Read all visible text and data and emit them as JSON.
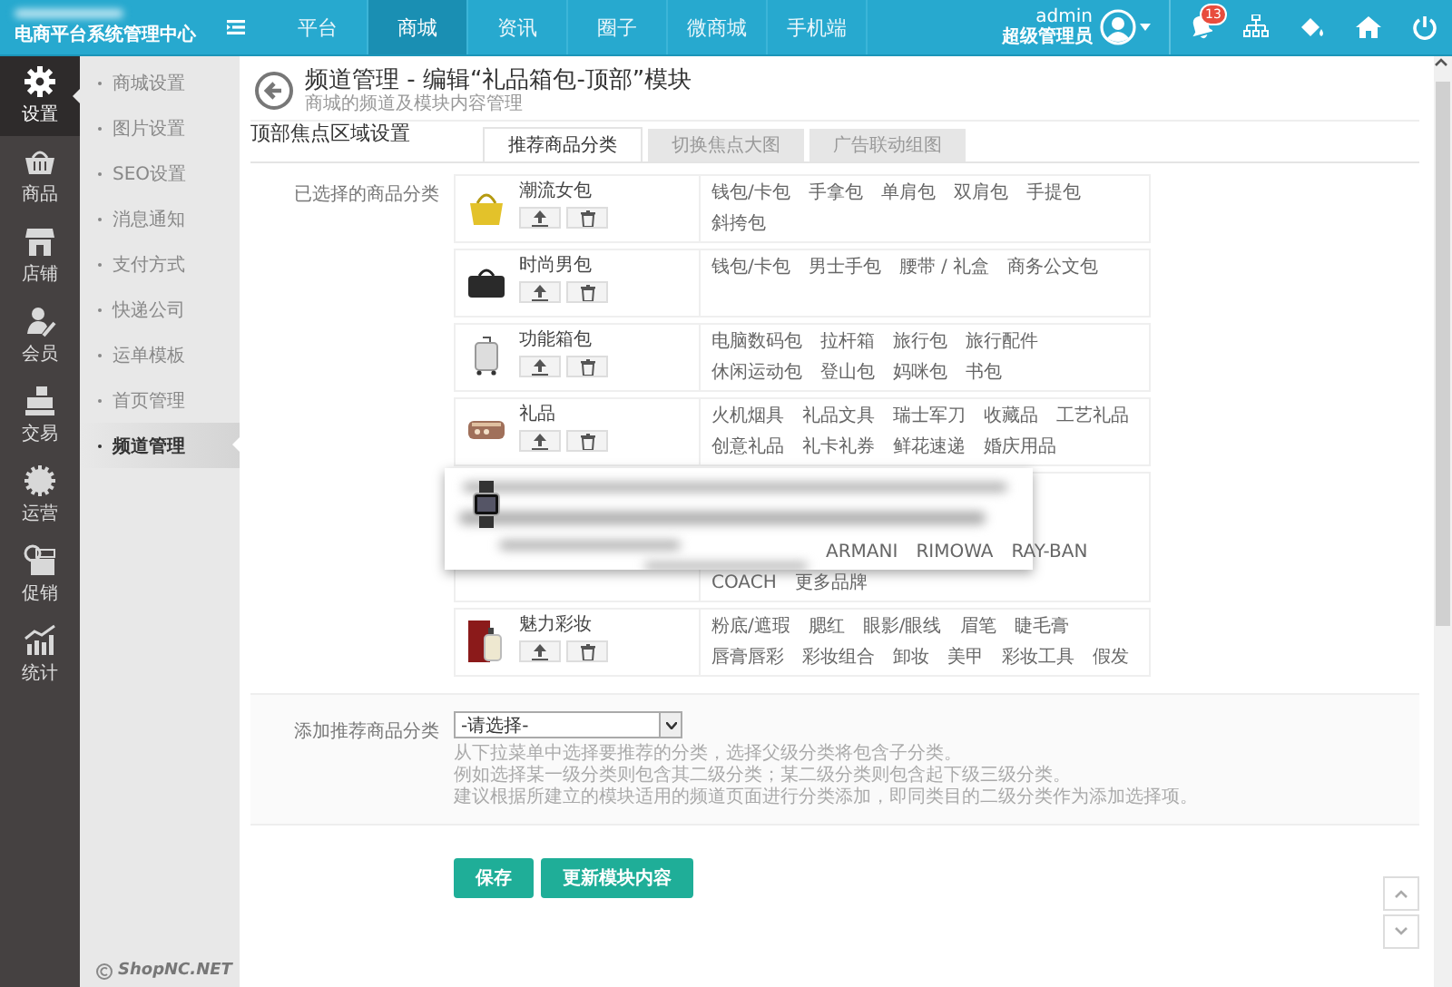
{
  "app": {
    "logo_text": "电商平台系统管理中心"
  },
  "nav": [
    {
      "label": "平台",
      "selected": false
    },
    {
      "label": "商城",
      "selected": true
    },
    {
      "label": "资讯",
      "selected": false
    },
    {
      "label": "圈子",
      "selected": false
    },
    {
      "label": "微商城",
      "selected": false
    },
    {
      "label": "手机端",
      "selected": false
    }
  ],
  "user": {
    "name": "admin",
    "role": "超级管理员"
  },
  "notifications": {
    "count": "13"
  },
  "sidebar": [
    {
      "label": "设置",
      "kind": "gear",
      "selected": true
    },
    {
      "label": "商品",
      "kind": "basket",
      "selected": false
    },
    {
      "label": "店铺",
      "kind": "shop",
      "selected": false
    },
    {
      "label": "会员",
      "kind": "member",
      "selected": false
    },
    {
      "label": "交易",
      "kind": "register",
      "selected": false
    },
    {
      "label": "运营",
      "kind": "badge",
      "selected": false
    },
    {
      "label": "促销",
      "kind": "promo",
      "selected": false
    },
    {
      "label": "统计",
      "kind": "chart",
      "selected": false
    }
  ],
  "submenu": [
    {
      "label": "商城设置",
      "selected": false
    },
    {
      "label": "图片设置",
      "selected": false
    },
    {
      "label": "SEO设置",
      "selected": false
    },
    {
      "label": "消息通知",
      "selected": false
    },
    {
      "label": "支付方式",
      "selected": false
    },
    {
      "label": "快递公司",
      "selected": false
    },
    {
      "label": "运单模板",
      "selected": false
    },
    {
      "label": "首页管理",
      "selected": false
    },
    {
      "label": "频道管理",
      "selected": true
    }
  ],
  "footer": "ShopNC.NET",
  "page": {
    "title": "频道管理 - 编辑“礼品箱包-顶部”模块",
    "subtitle": "商城的频道及模块内容管理"
  },
  "section": {
    "title": "顶部焦点区域设置"
  },
  "tabs": [
    {
      "label": "推荐商品分类",
      "selected": true
    },
    {
      "label": "切换焦点大图",
      "selected": false
    },
    {
      "label": "广告联动组图",
      "selected": false
    }
  ],
  "selected_categories": {
    "label": "已选择的商品分类",
    "rows": [
      {
        "name": "潮流女包",
        "kind": "handbag",
        "redacted": false,
        "items": [
          "钱包/卡包",
          "手拿包",
          "单肩包",
          "双肩包",
          "手提包",
          "斜挎包"
        ]
      },
      {
        "name": "时尚男包",
        "kind": "briefcase",
        "redacted": false,
        "items": [
          "钱包/卡包",
          "男士手包",
          "腰带 / 礼盒",
          "商务公文包"
        ]
      },
      {
        "name": "功能箱包",
        "kind": "luggage",
        "redacted": false,
        "items": [
          "电脑数码包",
          "拉杆箱",
          "旅行包",
          "旅行配件",
          "休闲运动包",
          "登山包",
          "妈咪包",
          "书包"
        ]
      },
      {
        "name": "礼品",
        "kind": "gift",
        "redacted": false,
        "items": [
          "火机烟具",
          "礼品文具",
          "瑞士军刀",
          "收藏品",
          "工艺礼品",
          "创意礼品",
          "礼卡礼券",
          "鲜花速递",
          "婚庆用品"
        ]
      },
      {
        "kind": "watch",
        "redacted": true,
        "items": [
          "ARMANI",
          "RIMOWA",
          "RAY-BAN",
          "COACH",
          "更多品牌"
        ]
      },
      {
        "name": "魅力彩妆",
        "kind": "perfume",
        "redacted": false,
        "items": [
          "粉底/遮瑕",
          "腮红",
          "眼影/眼线",
          "眉笔",
          "睫毛膏",
          "唇膏唇彩",
          "彩妆组合",
          "卸妆",
          "美甲",
          "彩妆工具",
          "假发"
        ]
      }
    ]
  },
  "add_category": {
    "label": "添加推荐商品分类",
    "select": {
      "value": "-请选择-"
    },
    "help": [
      "从下拉菜单中选择要推荐的分类，选择父级分类将包含子分类。",
      "例如选择某一级分类则包含其二级分类；某二级分类则包含起下级三级分类。",
      "建议根据所建立的模块适用的频道页面进行分类添加，即同类目的二级分类作为添加选择项。"
    ]
  },
  "buttons": [
    {
      "label": "保存"
    },
    {
      "label": "更新模块内容"
    }
  ]
}
